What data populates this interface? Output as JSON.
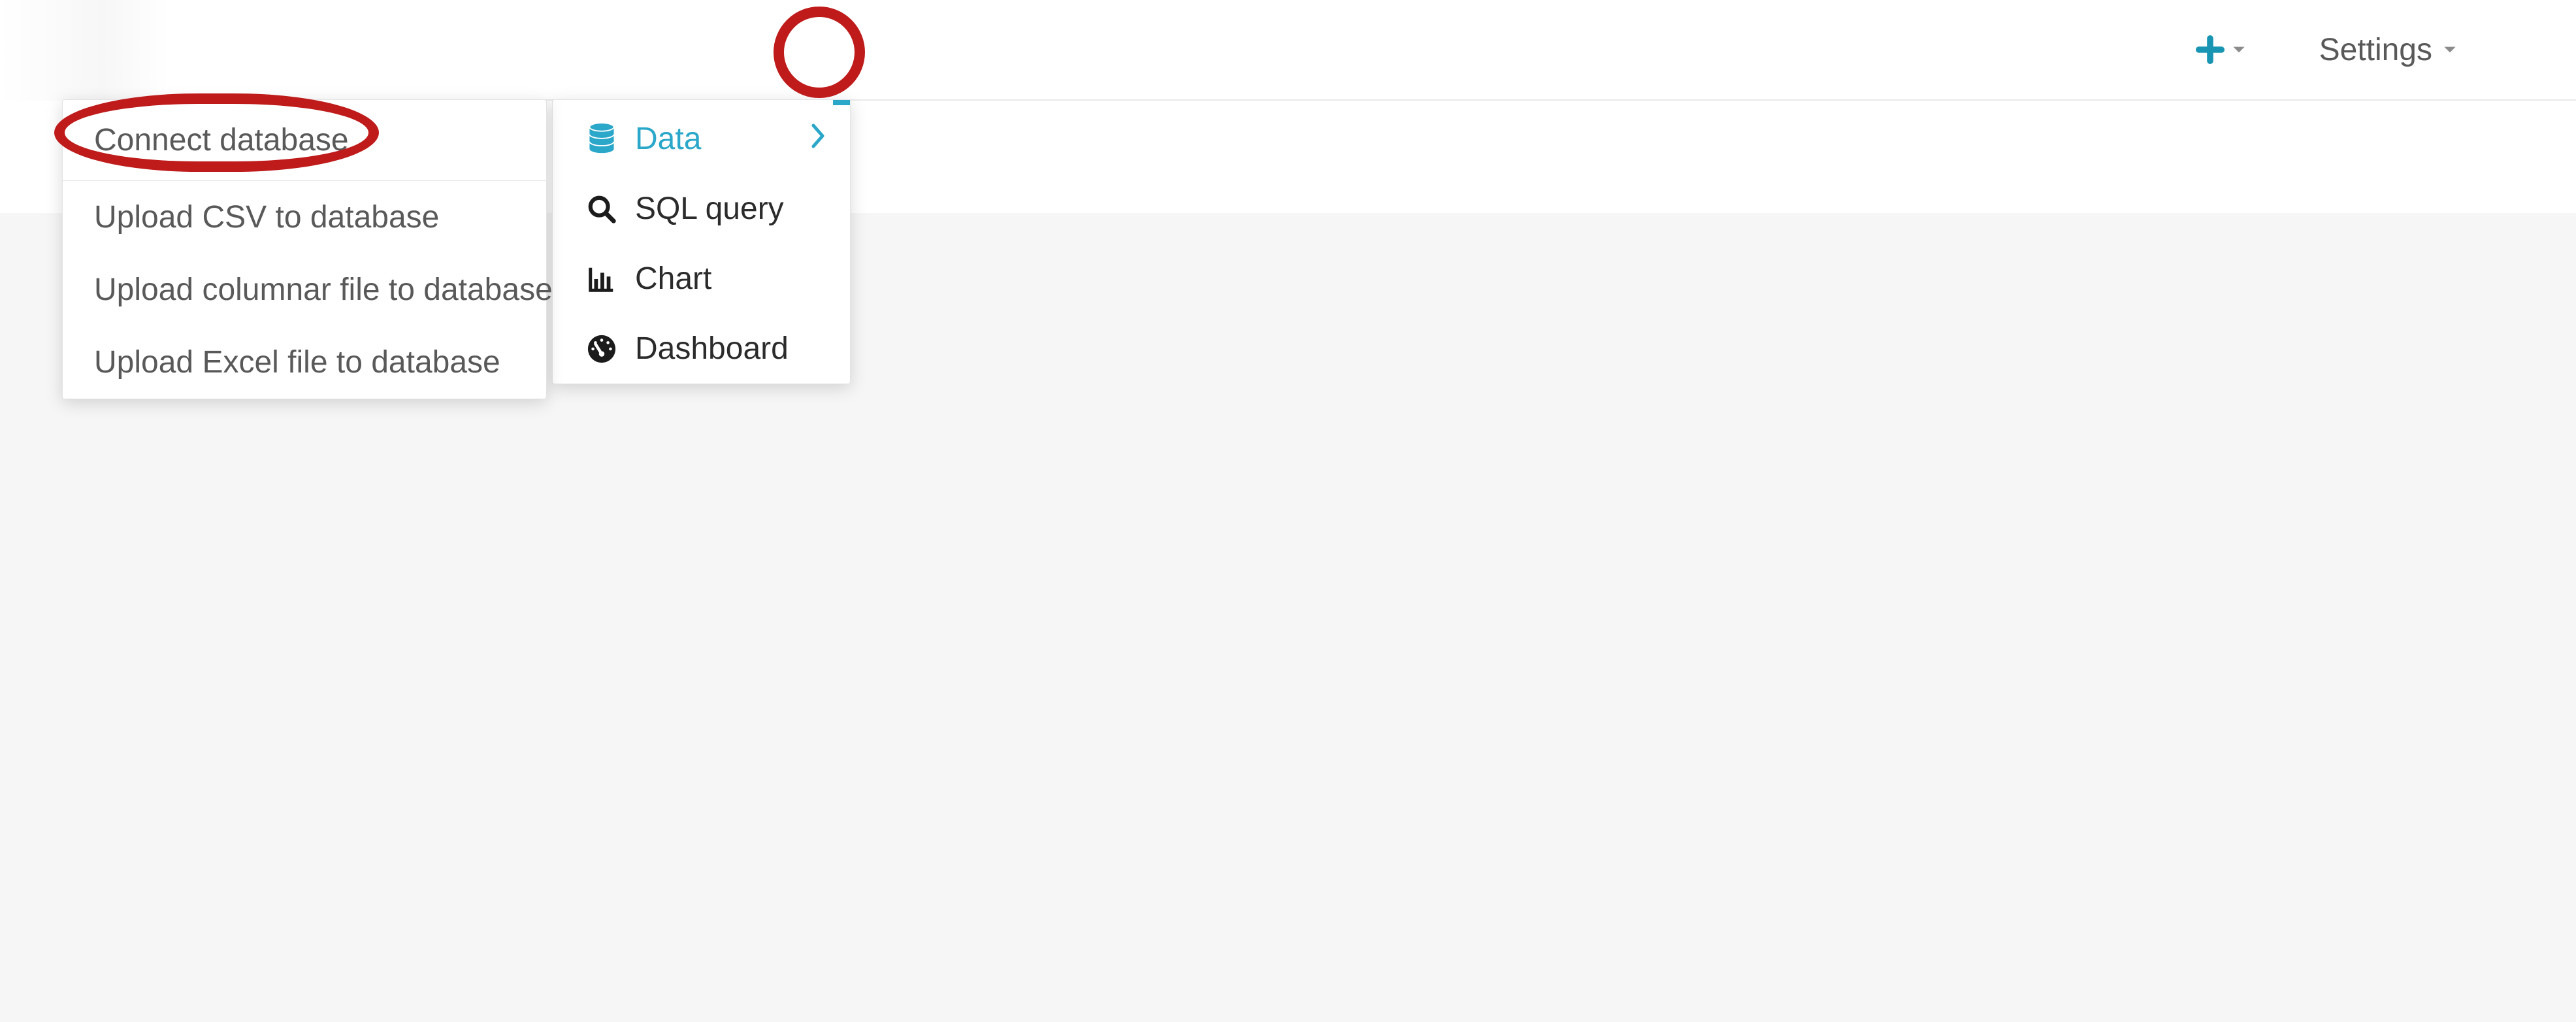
{
  "topbar": {
    "settings_label": "Settings"
  },
  "add_menu": {
    "items": [
      {
        "label": "Data",
        "icon": "database",
        "active": true,
        "has_submenu": true
      },
      {
        "label": "SQL query",
        "icon": "search"
      },
      {
        "label": "Chart",
        "icon": "bar-chart"
      },
      {
        "label": "Dashboard",
        "icon": "gauge"
      }
    ]
  },
  "data_submenu": {
    "items": [
      {
        "label": "Connect database",
        "highlighted": true
      },
      {
        "label": "Upload CSV to database"
      },
      {
        "label": "Upload columnar file to database"
      },
      {
        "label": "Upload Excel file to database"
      }
    ]
  },
  "annotations": {
    "highlight_new_button": true,
    "highlight_connect_database": true
  },
  "colors": {
    "accent": "#2aa7c9",
    "annotation": "#bf1b1b"
  }
}
